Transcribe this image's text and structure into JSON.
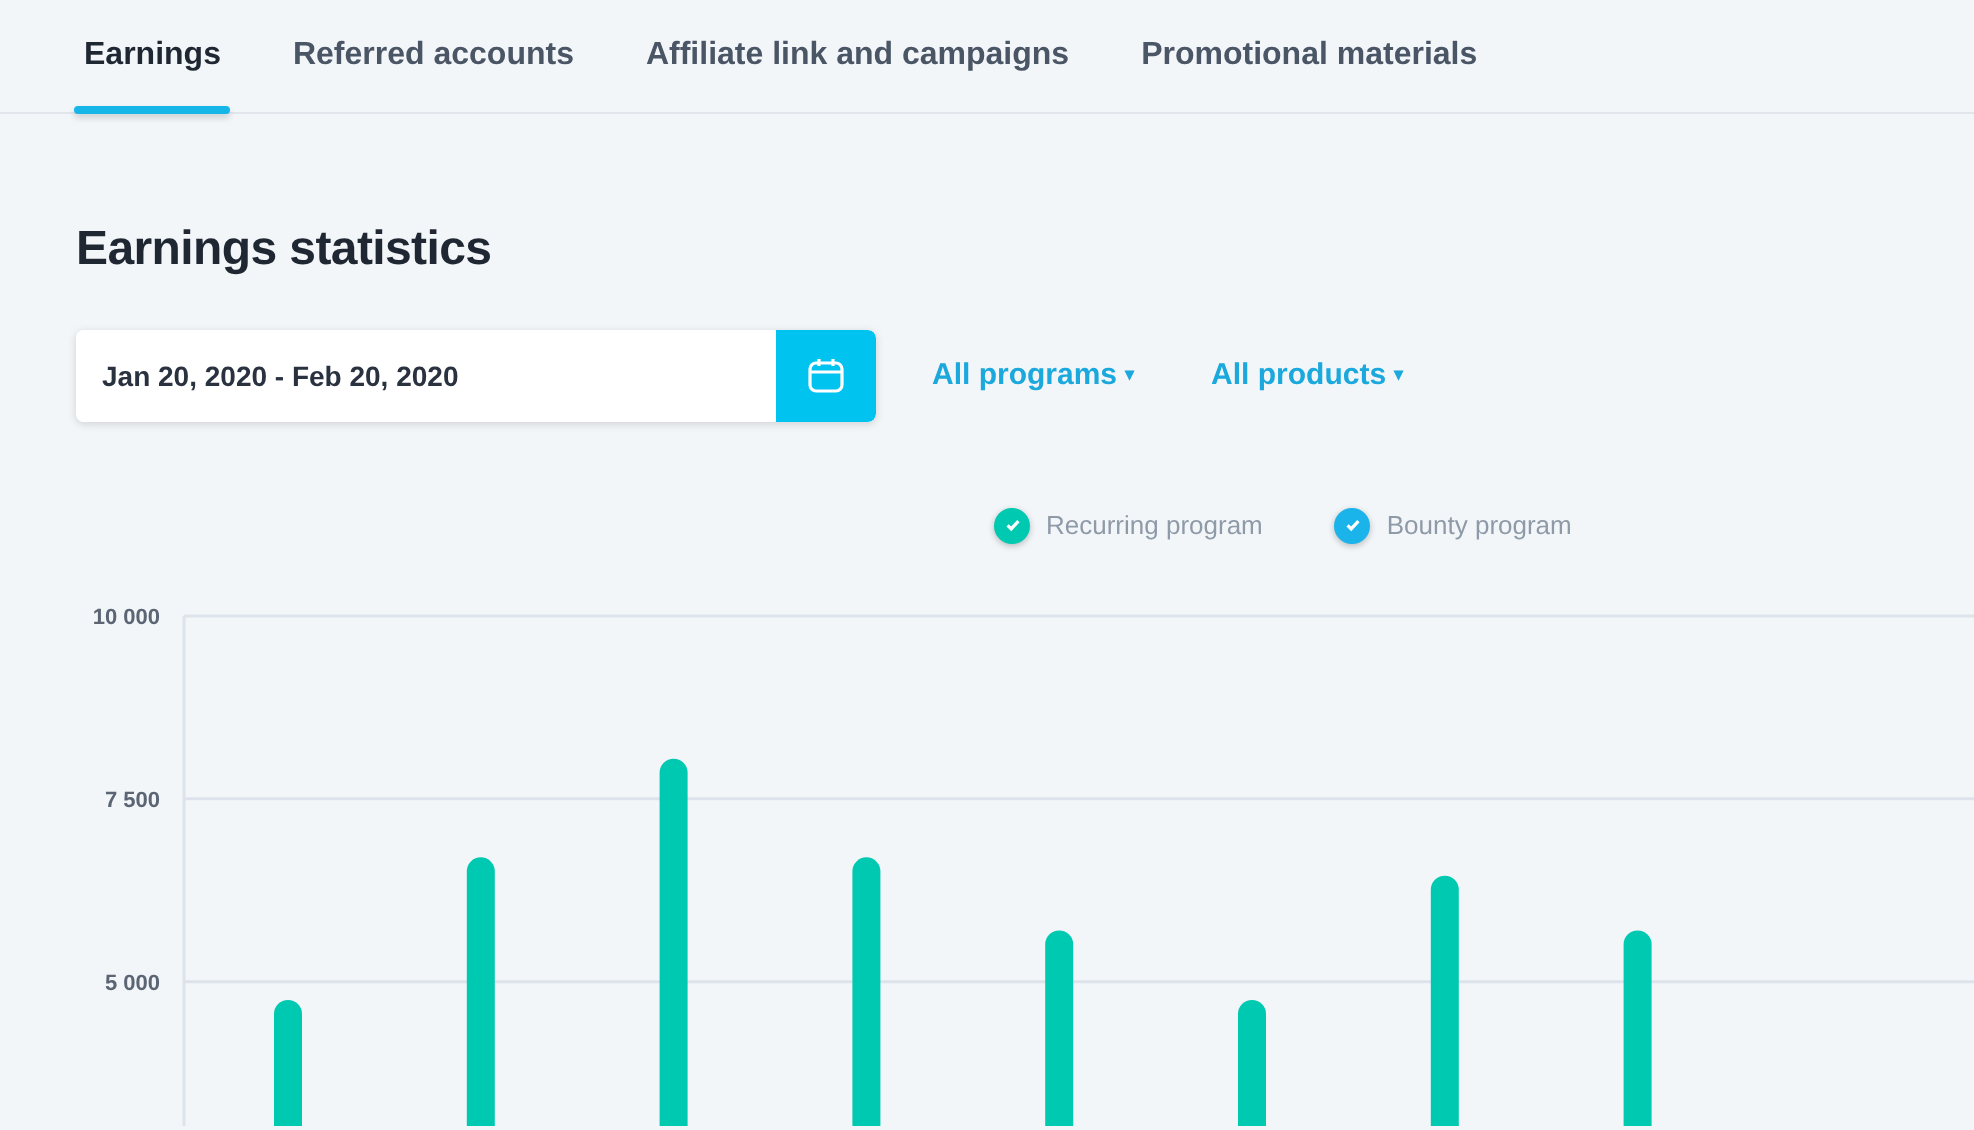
{
  "tabs": [
    {
      "label": "Earnings",
      "selected": true
    },
    {
      "label": "Referred accounts",
      "selected": false
    },
    {
      "label": "Affiliate link and campaigns",
      "selected": false
    },
    {
      "label": "Promotional materials",
      "selected": false
    }
  ],
  "title": "Earnings statistics",
  "date_range": {
    "value": "Jan 20, 2020 - Feb 20, 2020"
  },
  "filters": [
    {
      "label": "All programs",
      "caret": "▾"
    },
    {
      "label": "All products",
      "caret": "▾"
    }
  ],
  "legend": [
    {
      "label": "Recurring program",
      "color": "#00c9b1",
      "checked": true
    },
    {
      "label": "Bounty program",
      "color": "#1ab4ea",
      "checked": true
    }
  ],
  "chart_data": {
    "type": "bar",
    "ylim": [
      3000,
      10000
    ],
    "yticks": [
      {
        "value": 5000,
        "label": "5 000"
      },
      {
        "value": 7500,
        "label": "7 500"
      },
      {
        "value": 10000,
        "label": "10 000"
      }
    ],
    "series": [
      {
        "color": "#00c9b1",
        "values": [
          4750,
          6700,
          8050,
          6700,
          5700,
          4750,
          6450,
          5700
        ]
      }
    ]
  }
}
